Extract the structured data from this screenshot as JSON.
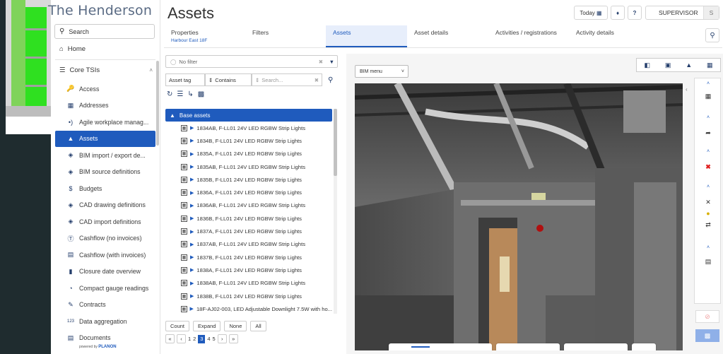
{
  "app": {
    "brand": "The Henderson",
    "title": "Assets",
    "powered_by": "powered by",
    "powered_brand": "PLANON"
  },
  "header": {
    "today_label": "Today",
    "user_label": "SUPERVISOR",
    "user_initial": "S"
  },
  "sidebar": {
    "search_label": "Search",
    "home_label": "Home",
    "section_label": "Core TSIs",
    "items": [
      {
        "label": "Access",
        "icon": "key-icon"
      },
      {
        "label": "Addresses",
        "icon": "address-book-icon"
      },
      {
        "label": "Agile workplace manag...",
        "icon": "wifi-icon"
      },
      {
        "label": "Assets",
        "icon": "assets-icon",
        "active": true
      },
      {
        "label": "BIM import / export de...",
        "icon": "cubes-icon"
      },
      {
        "label": "BIM source definitions",
        "icon": "cubes-icon"
      },
      {
        "label": "Budgets",
        "icon": "money-icon"
      },
      {
        "label": "CAD drawing definitions",
        "icon": "cubes-icon"
      },
      {
        "label": "CAD import definitions",
        "icon": "cubes-icon"
      },
      {
        "label": "Cashflow (no invoices)",
        "icon": "dollar-icon"
      },
      {
        "label": "Cashflow (with invoices)",
        "icon": "document-icon"
      },
      {
        "label": "Closure date overview",
        "icon": "lock-icon"
      },
      {
        "label": "Compact gauge readings",
        "icon": "gauge-icon"
      },
      {
        "label": "Contracts",
        "icon": "contract-icon"
      },
      {
        "label": "Data aggregation",
        "icon": "numbers-icon"
      },
      {
        "label": "Documents",
        "icon": "document-icon"
      }
    ]
  },
  "tabs": [
    {
      "label": "Properties",
      "sub": "Harbour East 18F"
    },
    {
      "label": "Filters",
      "sub": ""
    },
    {
      "label": "Assets",
      "sub": "",
      "active": true
    },
    {
      "label": "Asset details",
      "sub": ""
    },
    {
      "label": "Activities / registrations",
      "sub": ""
    },
    {
      "label": "Activity details",
      "sub": ""
    }
  ],
  "left_panel": {
    "filter_placeholder": "No filter",
    "field_select": "Asset tag",
    "operator_select": "Contains",
    "search_placeholder": "Search...",
    "root_label": "Base assets",
    "rows": [
      "1834AB, F-LL01 24V LED RGBW Strip Lights",
      "1834B, F-LL01 24V LED RGBW Strip Lights",
      "1835A, F-LL01 24V LED RGBW Strip Lights",
      "1835AB, F-LL01 24V LED RGBW Strip Lights",
      "1835B, F-LL01 24V LED RGBW Strip Lights",
      "1836A, F-LL01 24V LED RGBW Strip Lights",
      "1836AB, F-LL01 24V LED RGBW Strip Lights",
      "1836B, F-LL01 24V LED RGBW Strip Lights",
      "1837A, F-LL01 24V LED RGBW Strip Lights",
      "1837AB, F-LL01 24V LED RGBW Strip Lights",
      "1837B, F-LL01 24V LED RGBW Strip Lights",
      "1838A, F-LL01 24V LED RGBW Strip Lights",
      "1838AB, F-LL01 24V LED RGBW Strip Lights",
      "1838B, F-LL01 24V LED RGBW Strip Lights",
      "18F-AJ02-003, LED Adjustable Downlight 7.5W with ho..."
    ],
    "buttons": [
      "Count",
      "Expand",
      "None",
      "All"
    ],
    "pager": {
      "pages": [
        "1",
        "2",
        "3",
        "4",
        "5"
      ],
      "current": "3"
    }
  },
  "viewer": {
    "bim_menu_label": "BIM menu"
  },
  "colors": {
    "accent": "#1f5bbd",
    "danger": "#e02020"
  }
}
